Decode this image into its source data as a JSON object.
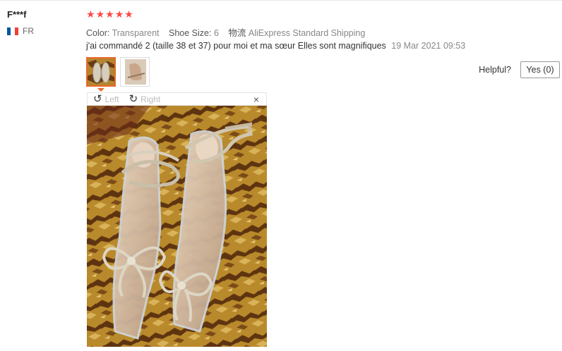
{
  "reviewer": {
    "name": "F***f",
    "country": "FR",
    "flag_colors": [
      "#0055a4",
      "#ffffff",
      "#ef4135"
    ]
  },
  "rating": {
    "stars": 5,
    "star_color": "#ff4747"
  },
  "meta": {
    "color_label": "Color:",
    "color_value": "Transparent",
    "size_label": "Shoe Size:",
    "size_value": "6",
    "shipping_label": "物流",
    "shipping_value": "AliExpress Standard Shipping"
  },
  "review": {
    "text": "j'ai commandé 2 (taille 38 et 37) pour moi et ma sœur Elles sont magnifiques",
    "date": "19 Mar 2021 09:53"
  },
  "helpful": {
    "label": "Helpful?",
    "button": "Yes (0)"
  },
  "viewer": {
    "rotate_left": "Left",
    "rotate_right": "Right",
    "close": "×"
  },
  "icons": [
    "rotate-left-icon",
    "rotate-right-icon",
    "close-icon",
    "star-icon",
    "flag-icon"
  ],
  "accent": "#e76a2d"
}
